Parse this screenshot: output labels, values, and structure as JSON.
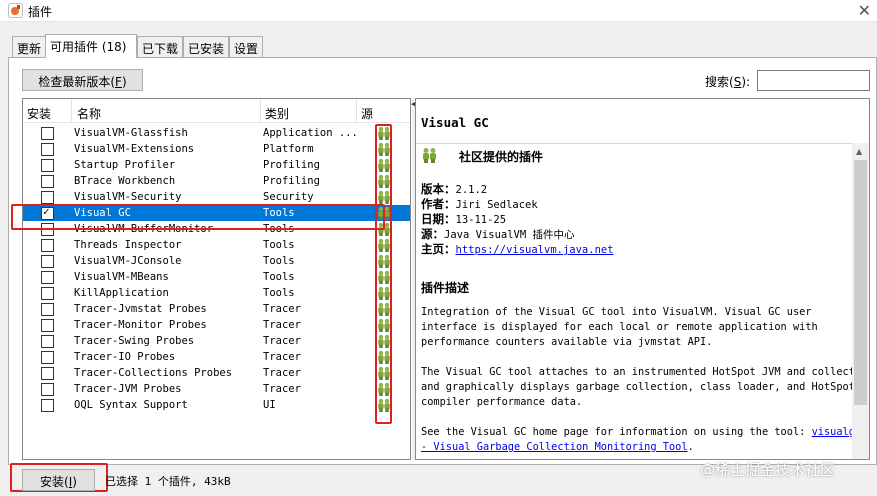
{
  "window": {
    "title": "插件",
    "close_glyph": "✕"
  },
  "tabs": [
    {
      "label": "更新",
      "active": false
    },
    {
      "label": "可用插件 (18)",
      "active": true
    },
    {
      "label": "已下载",
      "active": false
    },
    {
      "label": "已安装",
      "active": false
    },
    {
      "label": "设置",
      "active": false
    }
  ],
  "toolbar": {
    "check_label_prefix": "检查最新版本(",
    "check_mnemonic": "F",
    "check_label_suffix": ")",
    "search_label_prefix": "搜索(",
    "search_mnemonic": "S",
    "search_label_suffix": "):",
    "search_value": ""
  },
  "table": {
    "columns": [
      "安装",
      "名称",
      "类别",
      "源"
    ],
    "rows": [
      {
        "name": "VisualVM-Glassfish",
        "category": "Application ...",
        "checked": false,
        "selected": false
      },
      {
        "name": "VisualVM-Extensions",
        "category": "Platform",
        "checked": false,
        "selected": false
      },
      {
        "name": "Startup Profiler",
        "category": "Profiling",
        "checked": false,
        "selected": false
      },
      {
        "name": "BTrace Workbench",
        "category": "Profiling",
        "checked": false,
        "selected": false
      },
      {
        "name": "VisualVM-Security",
        "category": "Security",
        "checked": false,
        "selected": false
      },
      {
        "name": "Visual GC",
        "category": "Tools",
        "checked": true,
        "selected": true
      },
      {
        "name": "VisualVM-BufferMonitor",
        "category": "Tools",
        "checked": false,
        "selected": false
      },
      {
        "name": "Threads Inspector",
        "category": "Tools",
        "checked": false,
        "selected": false
      },
      {
        "name": "VisualVM-JConsole",
        "category": "Tools",
        "checked": false,
        "selected": false
      },
      {
        "name": "VisualVM-MBeans",
        "category": "Tools",
        "checked": false,
        "selected": false
      },
      {
        "name": "KillApplication",
        "category": "Tools",
        "checked": false,
        "selected": false
      },
      {
        "name": "Tracer-Jvmstat Probes",
        "category": "Tracer",
        "checked": false,
        "selected": false
      },
      {
        "name": "Tracer-Monitor Probes",
        "category": "Tracer",
        "checked": false,
        "selected": false
      },
      {
        "name": "Tracer-Swing Probes",
        "category": "Tracer",
        "checked": false,
        "selected": false
      },
      {
        "name": "Tracer-IO Probes",
        "category": "Tracer",
        "checked": false,
        "selected": false
      },
      {
        "name": "Tracer-Collections Probes",
        "category": "Tracer",
        "checked": false,
        "selected": false
      },
      {
        "name": "Tracer-JVM Probes",
        "category": "Tracer",
        "checked": false,
        "selected": false
      },
      {
        "name": "OQL Syntax Support",
        "category": "UI",
        "checked": false,
        "selected": false
      }
    ]
  },
  "detail": {
    "title": "Visual GC",
    "community_label": "社区提供的插件",
    "version_label": "版本：",
    "version": "2.1.2",
    "author_label": "作者：",
    "author": "Jiri Sedlacek",
    "date_label": "日期：",
    "date": "13-11-25",
    "source_label": "源：",
    "source": "Java VisualVM 插件中心",
    "homepage_label": "主页：",
    "homepage": "https://visualvm.java.net",
    "description_heading": "插件描述",
    "para1_lines": [
      "Integration of the Visual GC tool into VisualVM. Visual GC user",
      "interface is displayed for each local or remote application with",
      "performance counters available via jvmstat API."
    ],
    "para2_lines": [
      "The Visual GC tool attaches to an instrumented HotSpot JVM and collects",
      "and graphically displays garbage collection, class loader, and HotSpot",
      "compiler performance data."
    ],
    "para3_text": "See the Visual GC home page for information on using the tool: ",
    "para3_link1": "visualgc",
    "para3_link2": "- Visual Garbage Collection Monitoring Tool",
    "para3_end": "."
  },
  "footer": {
    "install_prefix": "安装(",
    "install_mnemonic": "I",
    "install_suffix": ")",
    "status": "已选择 1 个插件, 43kB"
  },
  "watermark": "@稀土掘金技术社区",
  "colors": {
    "selection": "#0078d7",
    "highlight": "#e02020",
    "link": "#0000ee"
  }
}
